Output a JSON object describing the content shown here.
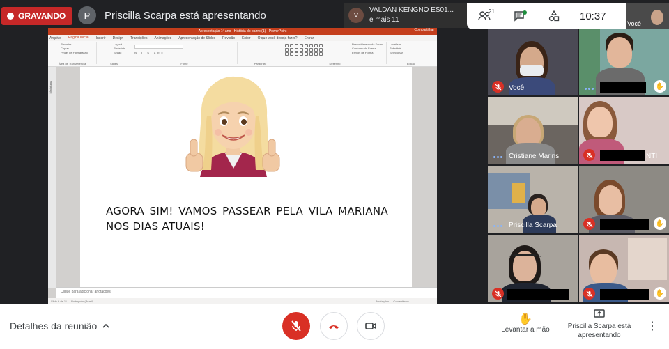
{
  "recording": {
    "label": "GRAVANDO"
  },
  "presenter_banner": {
    "avatar_letter": "P",
    "text": "Priscilla Scarpa está apresentando"
  },
  "joiners": {
    "names": "VALDAN KENGNO ES01...",
    "more": "e mais 11",
    "avatar_letter": "V"
  },
  "top_controls": {
    "participants_count": "21",
    "time": "10:37",
    "self_label": "Você"
  },
  "powerpoint": {
    "title": "Apresentação 1º ano - História do bairro (1) - PowerPoint",
    "share_label": "Compartilhar",
    "tabs": [
      "Arquivo",
      "Página Inicial",
      "Inserir",
      "Design",
      "Transições",
      "Animações",
      "Apresentação de Slides",
      "Revisão",
      "Exibir",
      "O que você deseja fazer?",
      "Entrar"
    ],
    "ribbon_groups": [
      "Área de Transferência",
      "Slides",
      "Fonte",
      "Parágrafo",
      "Desenho",
      "Edição"
    ],
    "ribbon_items": {
      "clipboard": [
        "Recortar",
        "Copiar",
        "Pincel de Formatação"
      ],
      "slides": [
        "Layout",
        "Redefinir",
        "Seção"
      ],
      "editing": [
        "Localizar",
        "Substituir",
        "Selecionar"
      ],
      "drawing": [
        "Preenchimento da Forma",
        "Contorno da Forma",
        "Efeitos de Forma"
      ]
    },
    "left_panel": "Miniaturas",
    "slide_text": "AGORA SIM! VAMOS PASSEAR PELA VILA MARIANA NOS DIAS ATUAIS!",
    "notes_placeholder": "Clique para adicionar anotações",
    "status": [
      "Slide 6 de 11",
      "Português (Brasil)",
      "Anotações",
      "Comentários"
    ]
  },
  "participants": [
    {
      "name": "Você",
      "muted": true
    },
    {
      "name": "",
      "muted": false,
      "hand": true
    },
    {
      "name": "Cristiane Marins",
      "muted": false
    },
    {
      "name": "NTI",
      "muted": true
    },
    {
      "name": "Priscilla Scarpa",
      "muted": false
    },
    {
      "name": "",
      "muted": true,
      "hand": true
    },
    {
      "name": "",
      "muted": true
    },
    {
      "name": "",
      "muted": true,
      "hand": true
    }
  ],
  "bottom": {
    "details": "Detalhes da reunião",
    "raise_hand": "Levantar a mão",
    "presenting": "Priscilla Scarpa está apresentando"
  },
  "colors": {
    "red": "#d93025",
    "ppt_orange": "#c43e1c",
    "recording": "#c62828",
    "bg": "#202124"
  }
}
